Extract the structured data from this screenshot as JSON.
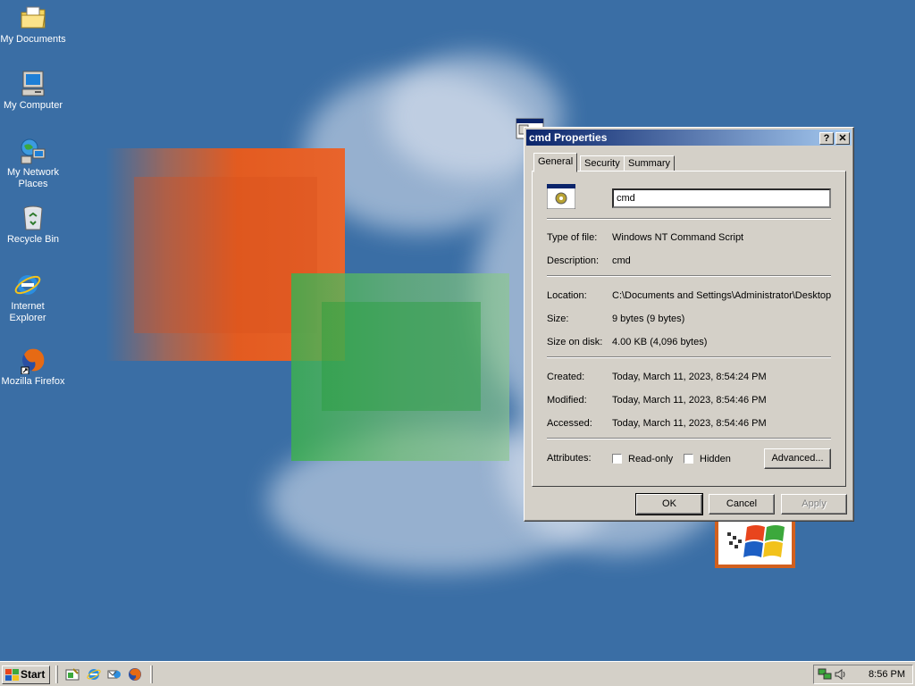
{
  "desktop": {
    "icons": [
      {
        "label": "My Documents",
        "icon": "folder-documents-icon"
      },
      {
        "label": "My Computer",
        "icon": "computer-icon"
      },
      {
        "label": "My Network Places",
        "icon": "network-icon"
      },
      {
        "label": "Recycle Bin",
        "icon": "recycle-bin-icon"
      },
      {
        "label": "Internet Explorer",
        "icon": "internet-explorer-icon"
      },
      {
        "label": "Mozilla Firefox",
        "icon": "firefox-icon"
      }
    ],
    "background_color": "#3a6ea5"
  },
  "dialog": {
    "title": "cmd Properties",
    "help_btn": "?",
    "close_btn": "✕",
    "tabs": [
      {
        "label": "General",
        "active": true
      },
      {
        "label": "Security",
        "active": false
      },
      {
        "label": "Summary",
        "active": false
      }
    ],
    "file_name": "cmd",
    "type_label": "Type of file:",
    "type_value": "Windows NT Command Script",
    "desc_label": "Description:",
    "desc_value": "cmd",
    "location_label": "Location:",
    "location_value": "C:\\Documents and Settings\\Administrator\\Desktop",
    "size_label": "Size:",
    "size_value": "9 bytes (9 bytes)",
    "size_disk_label": "Size on disk:",
    "size_disk_value": "4.00 KB (4,096 bytes)",
    "created_label": "Created:",
    "created_value": "Today, March 11, 2023, 8:54:24 PM",
    "modified_label": "Modified:",
    "modified_value": "Today, March 11, 2023, 8:54:46 PM",
    "accessed_label": "Accessed:",
    "accessed_value": "Today, March 11, 2023, 8:54:46 PM",
    "attributes_label": "Attributes:",
    "readonly_label": "Read-only",
    "readonly_checked": false,
    "hidden_label": "Hidden",
    "hidden_checked": false,
    "advanced_btn": "Advanced...",
    "ok_btn": "OK",
    "cancel_btn": "Cancel",
    "apply_btn": "Apply"
  },
  "taskbar": {
    "start_label": "Start",
    "quick_launch": [
      "show-desktop-icon",
      "internet-explorer-icon",
      "outlook-express-icon",
      "firefox-icon"
    ],
    "clock": "8:56 PM"
  }
}
